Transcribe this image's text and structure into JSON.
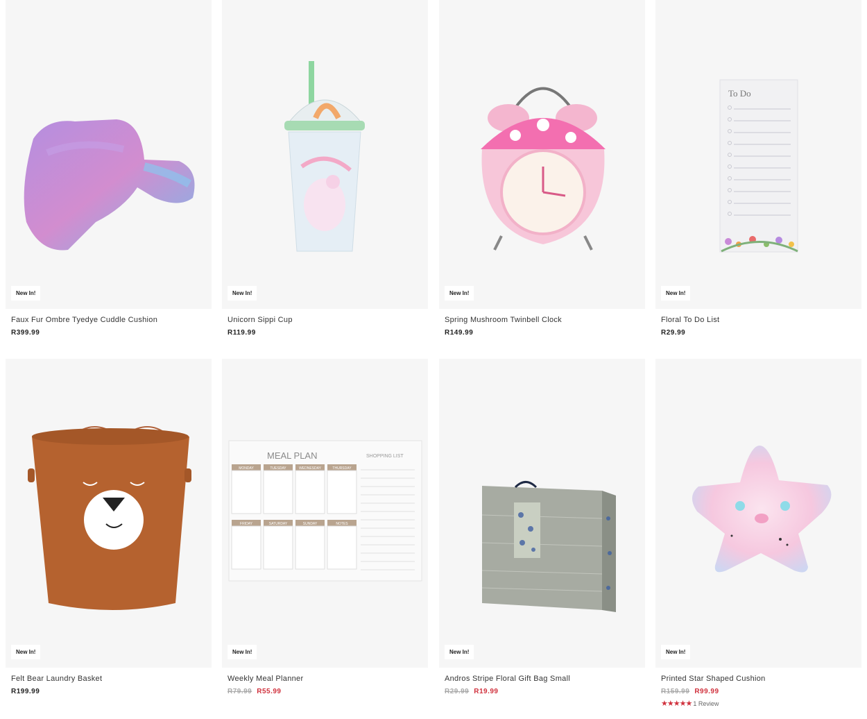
{
  "products": [
    {
      "badge": "New In!",
      "name": "Faux Fur Ombre Tyedye Cuddle Cushion",
      "price": "R399.99",
      "image_icon": "cushion-image"
    },
    {
      "badge": "New In!",
      "name": "Unicorn Sippi Cup",
      "price": "R119.99",
      "image_icon": "sippy-cup-image"
    },
    {
      "badge": "New In!",
      "name": "Spring Mushroom Twinbell Clock",
      "price": "R149.99",
      "image_icon": "clock-image"
    },
    {
      "badge": "New In!",
      "name": "Floral To Do List",
      "price": "R29.99",
      "image_icon": "todo-list-image",
      "art_text": "To Do"
    },
    {
      "badge": "New In!",
      "name": "Felt Bear Laundry Basket",
      "price": "R199.99",
      "image_icon": "laundry-basket-image"
    },
    {
      "badge": "New In!",
      "name": "Weekly Meal Planner",
      "old_price": "R79.99",
      "sale_price": "R55.99",
      "image_icon": "meal-planner-image",
      "art_text": "MEAL PLAN",
      "art_subtext": "SHOPPING LIST",
      "art_days": [
        "MONDAY",
        "TUESDAY",
        "WEDNESDAY",
        "THURSDAY",
        "FRIDAY",
        "SATURDAY",
        "SUNDAY",
        "NOTES"
      ]
    },
    {
      "badge": "New In!",
      "name": "Andros Stripe Floral Gift Bag Small",
      "old_price": "R29.99",
      "sale_price": "R19.99",
      "image_icon": "gift-bag-image"
    },
    {
      "badge": "New In!",
      "name": "Printed Star Shaped Cushion",
      "old_price": "R159.99",
      "sale_price": "R99.99",
      "rating": 5,
      "reviews": "1 Review",
      "image_icon": "star-cushion-image"
    }
  ],
  "colors": {
    "card_bg": "#f6f6f6",
    "sale": "#d0313d",
    "strike": "#aaaaaa",
    "text": "#222222"
  }
}
